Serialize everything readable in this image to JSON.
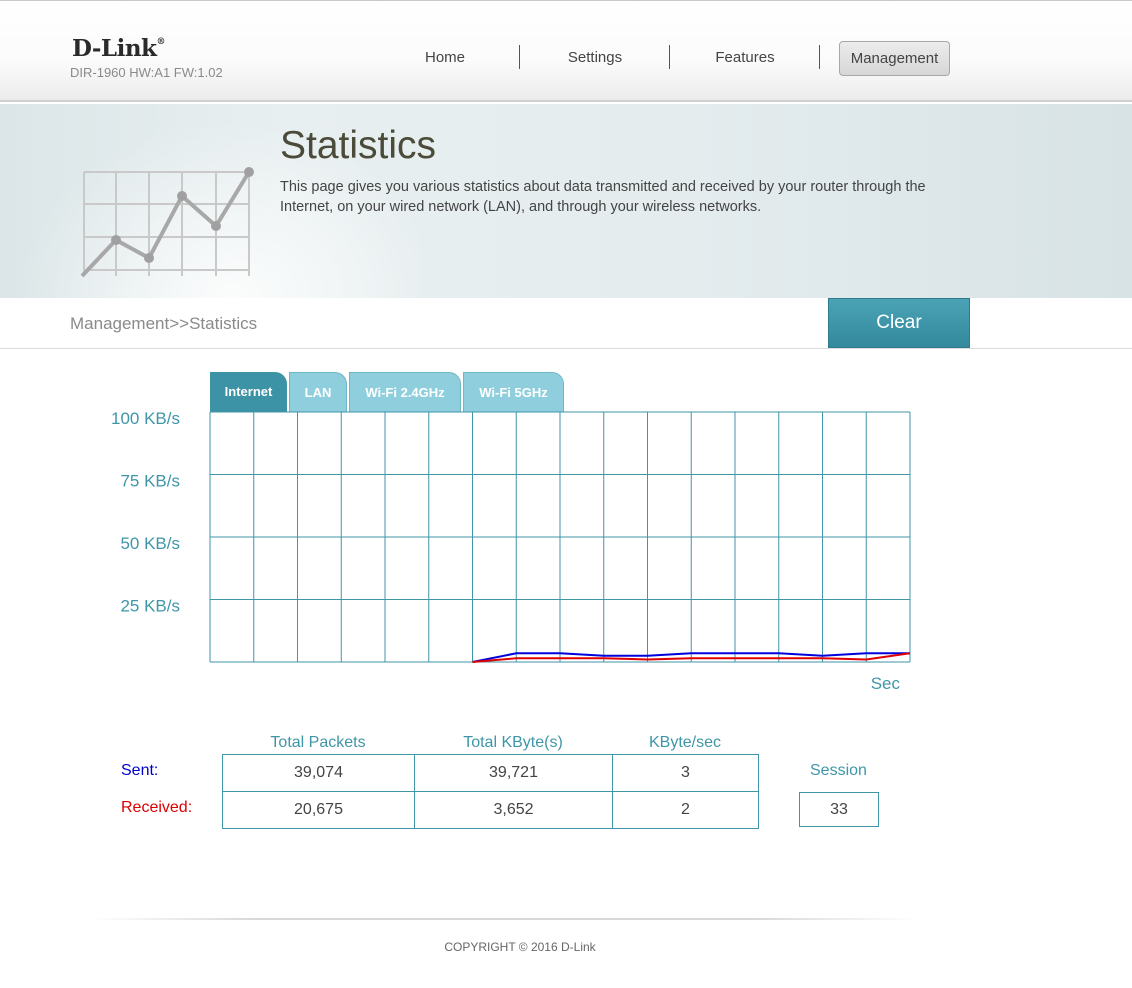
{
  "header": {
    "logo_text": "D-Link",
    "logo_mark": "®",
    "model": "DIR-1960 HW:A1 FW:1.02",
    "nav": [
      {
        "label": "Home"
      },
      {
        "label": "Settings"
      },
      {
        "label": "Features"
      },
      {
        "label": "Management",
        "selected": true
      }
    ]
  },
  "banner": {
    "title": "Statistics",
    "description": "This page gives you various statistics about data transmitted and received by your router through the Internet, on your wired network (LAN), and through your wireless networks.",
    "icon": "line-chart-illustration-icon"
  },
  "breadcrumb": "Management>>Statistics",
  "clear_button": "Clear",
  "tabs": [
    {
      "label": "Internet",
      "active": true
    },
    {
      "label": "LAN",
      "active": false
    },
    {
      "label": "Wi-Fi 2.4GHz",
      "active": false
    },
    {
      "label": "Wi-Fi 5GHz",
      "active": false
    }
  ],
  "chart_data": {
    "type": "line",
    "title": "",
    "xlabel": "Sec",
    "ylabel": "",
    "y_tick_labels": [
      "100 KB/s",
      "75 KB/s",
      "50 KB/s",
      "25 KB/s"
    ],
    "y_ticks": [
      100,
      75,
      50,
      25
    ],
    "ylim": [
      0,
      100
    ],
    "x_count": 16,
    "grid": true,
    "series": [
      {
        "color": "#0000dd",
        "values": [
          null,
          null,
          null,
          null,
          null,
          null,
          0,
          3.5,
          3.5,
          2.5,
          2.5,
          3.5,
          3.5,
          3.5,
          2.5,
          3.5,
          3.5
        ]
      },
      {
        "color": "#e00000",
        "values": [
          null,
          null,
          null,
          null,
          null,
          null,
          0,
          1.5,
          1.5,
          1.5,
          1,
          1.5,
          1.5,
          1.5,
          1.5,
          1,
          3.5
        ]
      }
    ],
    "colors": {
      "grid": "#3f96a8",
      "label": "#3f96a8"
    }
  },
  "stats": {
    "headers": [
      "Total Packets",
      "Total KByte(s)",
      "KByte/sec"
    ],
    "rows": [
      {
        "label": "Sent:",
        "color": "#0000cc",
        "values": [
          "39,074",
          "39,721",
          "3"
        ]
      },
      {
        "label": "Received:",
        "color": "#dd0000",
        "values": [
          "20,675",
          "3,652",
          "2"
        ]
      }
    ],
    "session_label": "Session",
    "session_value": "33"
  },
  "footer": {
    "copyright": "COPYRIGHT © 2016 D-Link"
  },
  "colors": {
    "accent": "#3f96a8",
    "clear_button": "#3c93a6",
    "tab_active": "#3c93a6",
    "tab_inactive": "#8fcfdd"
  }
}
